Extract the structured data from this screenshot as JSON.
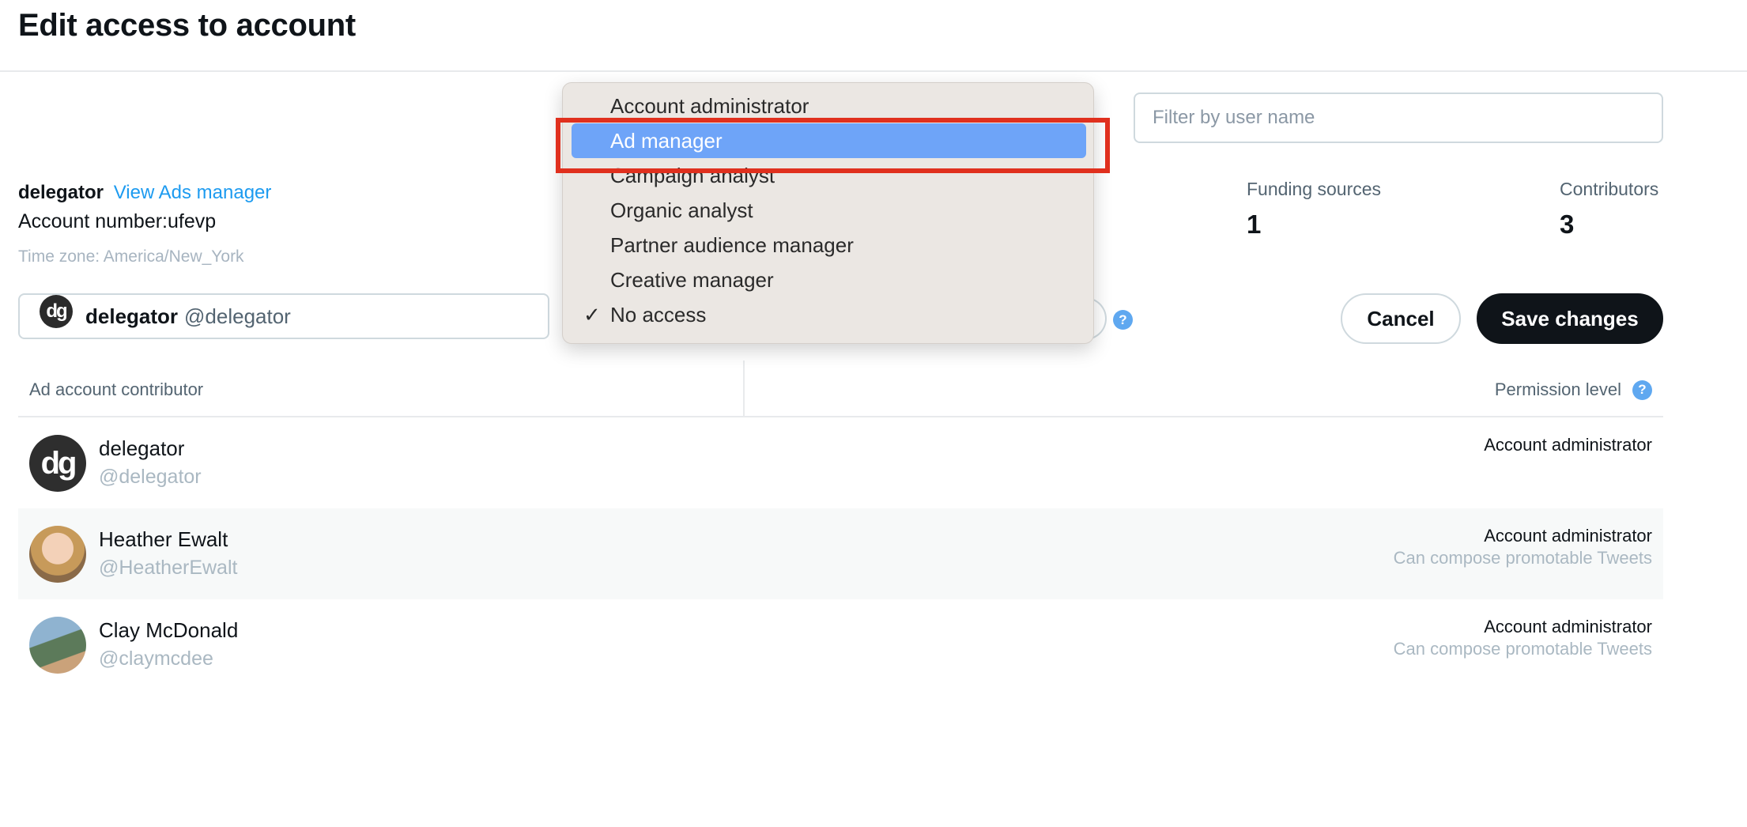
{
  "page": {
    "title": "Edit access to account"
  },
  "filter": {
    "placeholder": "Filter by user name"
  },
  "account": {
    "name": "delegator",
    "ads_manager_link": "View Ads manager",
    "number_line": "Account number:ufevp",
    "timezone_line": "Time zone: America/New_York"
  },
  "stats": {
    "funding_label": "Funding sources",
    "funding_value": "1",
    "contributors_label": "Contributors",
    "contributors_value": "3"
  },
  "selected_user": {
    "avatar_text": "dg",
    "name": "delegator",
    "handle": "@delegator"
  },
  "buttons": {
    "help": "?",
    "cancel": "Cancel",
    "save": "Save changes"
  },
  "table": {
    "col_contributor": "Ad account contributor",
    "col_permission": "Permission level",
    "rows": [
      {
        "avatar_text": "dg",
        "name": "delegator",
        "handle": "@delegator",
        "permission": "Account administrator",
        "sub": ""
      },
      {
        "avatar_text": "",
        "name": "Heather Ewalt",
        "handle": "@HeatherEwalt",
        "permission": "Account administrator",
        "sub": "Can compose promotable Tweets"
      },
      {
        "avatar_text": "",
        "name": "Clay McDonald",
        "handle": "@claymcdee",
        "permission": "Account administrator",
        "sub": "Can compose promotable Tweets"
      }
    ]
  },
  "menu": {
    "items": [
      {
        "label": "Account administrator"
      },
      {
        "label": "Ad manager",
        "highlighted": true
      },
      {
        "label": "Campaign analyst"
      },
      {
        "label": "Organic analyst"
      },
      {
        "label": "Partner audience manager"
      },
      {
        "label": "Creative manager"
      },
      {
        "label": "No access",
        "checked": true
      }
    ],
    "check_glyph": "✓"
  },
  "colors": {
    "accent": "#1d9bf0",
    "menu_highlight": "#6ea4f8",
    "annotation_box": "#e0301e"
  }
}
